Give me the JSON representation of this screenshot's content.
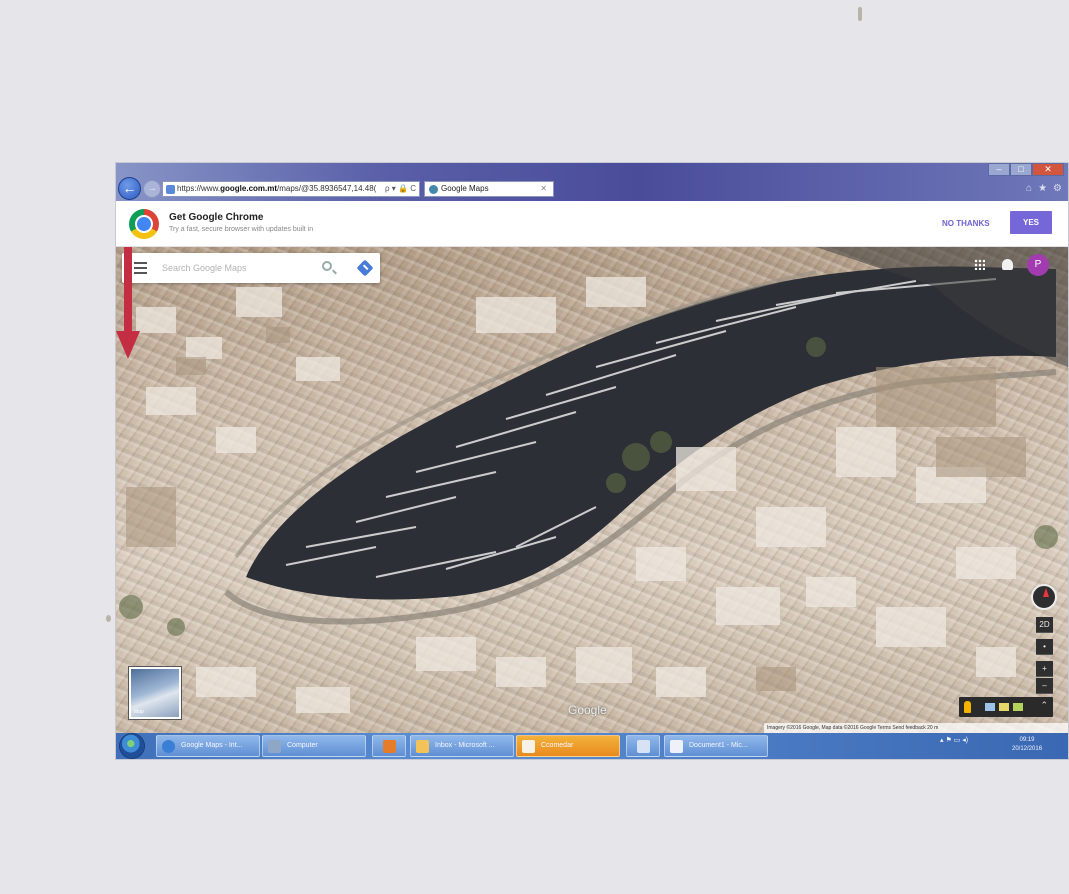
{
  "browser": {
    "url_prefix": "https://www.",
    "url_domain": "google.com.mt",
    "url_path": "/maps/@35.8936547,14.48(",
    "address_tools": "ρ ▾ 🔒 C",
    "tab_label": "Google Maps",
    "tab_close": "✕",
    "back_glyph": "←",
    "forward_glyph": "→",
    "window_minimize": "–",
    "window_maximize": "□",
    "window_close": "✕",
    "home_glyph": "⌂",
    "favorites_glyph": "★",
    "settings_glyph": "⚙"
  },
  "promo": {
    "title": "Get Google Chrome",
    "subtitle": "Try a fast, secure browser with updates built in",
    "no_thanks_label": "NO THANKS",
    "yes_label": "YES"
  },
  "map": {
    "search_placeholder": "Search Google Maps",
    "avatar_letter": "P",
    "earth_label": "Map",
    "tilt_label": "2D",
    "zoom_in_label": "+",
    "zoom_out_label": "–",
    "pan_label": "•",
    "google_logo": "Google",
    "layers_chevron": "⌃",
    "attribution": "Imagery ©2016 Google, Map data ©2016 Google   Terms   Send feedback   20 m",
    "colors": {
      "arrow": "#c42e43",
      "water": "#2c2f35",
      "avatar": "#a23bb0"
    }
  },
  "taskbar": {
    "items": [
      {
        "label": "Google Maps - Int..."
      },
      {
        "label": "Computer"
      },
      {
        "label": ""
      },
      {
        "label": "Inbox - Microsoft ..."
      },
      {
        "label": "Ccomedar"
      },
      {
        "label": ""
      },
      {
        "label": "Document1 - Mic..."
      }
    ],
    "tray_icons": "▴  ⚑  ▭  ◂)",
    "clock_time": "09:19",
    "clock_date": "20/12/2016"
  }
}
